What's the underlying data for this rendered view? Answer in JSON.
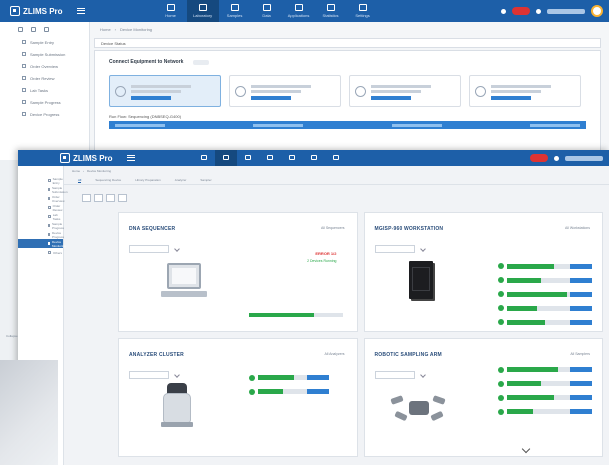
{
  "app": {
    "back_logo": "ZLIMS Pro",
    "front_logo": "ZLIMS Pro",
    "top_nav": [
      "Home",
      "Laboratory",
      "Samples",
      "Data",
      "Applications",
      "Statistics",
      "Settings"
    ],
    "back_active_nav_index": 1,
    "front_active_nav_index": 1,
    "accent_color": "#1d5fa8",
    "status_colors": {
      "ok": "#2aa84a",
      "alert": "#dd3333",
      "run": "#2f7fd1"
    }
  },
  "back_window": {
    "sidebar": [
      "Sample Entry",
      "Sample Submission",
      "Order Overview",
      "Order Review",
      "Lab Tasks",
      "Sample Progress",
      "Device Progress"
    ],
    "breadcrumb": [
      "Home",
      "Device Monitoring"
    ],
    "panel_tag": "Device Status",
    "panel_title": "Connect Equipment to Network",
    "device_cards": [
      "Sequencer: DNBSEQ-G400",
      "Sequencer: DNBSEQ-G400",
      "Sequencer: DNBSEQ-G400",
      "Sequencer: DNBSEQ-G400"
    ],
    "run_label": "Run Flow: Sequencing (DNBSEQ-G400)"
  },
  "front_window": {
    "sidebar": [
      "Sample Entry",
      "Sample Submission",
      "Order Overview",
      "Order Review",
      "Lab Tasks",
      "Sample Progress",
      "Device Progress",
      "Device Monitoring",
      "Others"
    ],
    "active_sidebar_index": 7,
    "side_bottom_label": "Collapse",
    "breadcrumb": [
      "Home",
      "Device Monitoring"
    ],
    "tabs": [
      "All",
      "Sequencing Device",
      "Library Preparation",
      "Analyzer",
      "Sampler"
    ],
    "active_tab_index": 0,
    "cards": [
      {
        "title": "DNA SEQUENCER",
        "meta": "All Sequencers",
        "progress": 0.7
      },
      {
        "title": "MGISP-960 WORKSTATION",
        "meta": "All Workstations"
      },
      {
        "title": "ANALYZER CLUSTER",
        "meta": "All Analyzers"
      },
      {
        "title": "ROBOTIC SAMPLING ARM",
        "meta": "All Samplers"
      }
    ],
    "sequencer_status": {
      "alert": "ERROR 1/2",
      "ok": "2 Devices Running"
    },
    "workstation_rows": [
      0.55,
      0.4,
      0.7,
      0.35,
      0.45
    ],
    "analyzer_rows": [
      0.5,
      0.35
    ],
    "sampler_rows": [
      0.6,
      0.4,
      0.55,
      0.3
    ]
  }
}
